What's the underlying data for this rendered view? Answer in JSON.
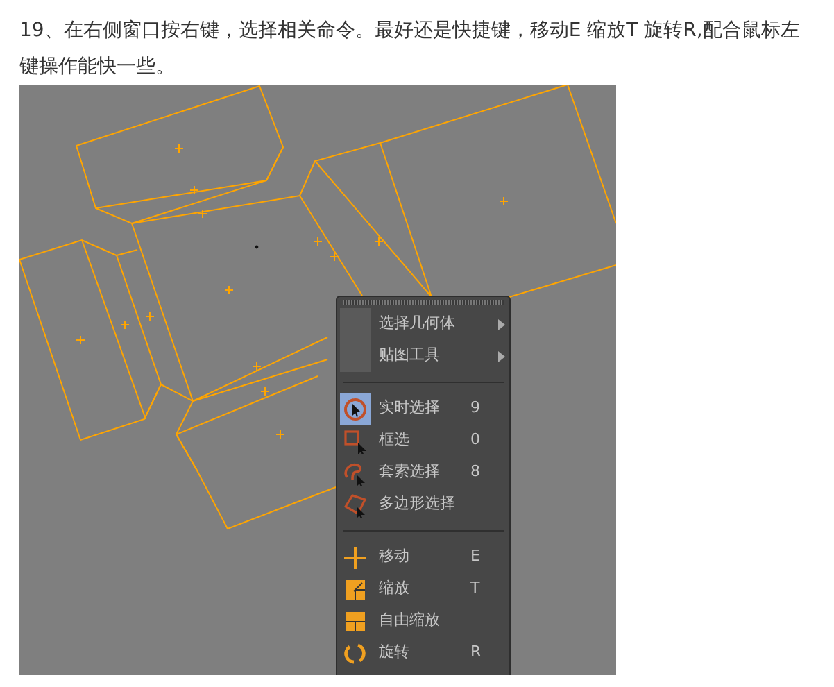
{
  "instruction": {
    "text": "19、在右侧窗口按右键，选择相关命令。最好还是快捷键，移动E 缩放T 旋转R,配合鼠标左键操作能快一些。"
  },
  "viewport": {
    "menu": {
      "groups": [
        {
          "items": [
            {
              "kind": "submenu",
              "label": "选择几何体",
              "selected": false
            },
            {
              "kind": "submenu",
              "label": "贴图工具",
              "selected": false
            }
          ]
        },
        {
          "items": [
            {
              "kind": "tool",
              "label": "实时选择",
              "shortcut": "9",
              "selected": true
            },
            {
              "kind": "tool",
              "label": "框选",
              "shortcut": "0",
              "selected": false
            },
            {
              "kind": "tool",
              "label": "套索选择",
              "shortcut": "8",
              "selected": false
            },
            {
              "kind": "tool",
              "label": "多边形选择",
              "selected": false
            }
          ]
        },
        {
          "items": [
            {
              "kind": "tool",
              "label": "移动",
              "shortcut": "E",
              "selected": false
            },
            {
              "kind": "tool",
              "label": "缩放",
              "shortcut": "T",
              "selected": false
            },
            {
              "kind": "tool",
              "label": "自由缩放",
              "selected": false
            },
            {
              "kind": "tool",
              "label": "旋转",
              "shortcut": "R",
              "selected": false
            }
          ]
        }
      ]
    }
  }
}
